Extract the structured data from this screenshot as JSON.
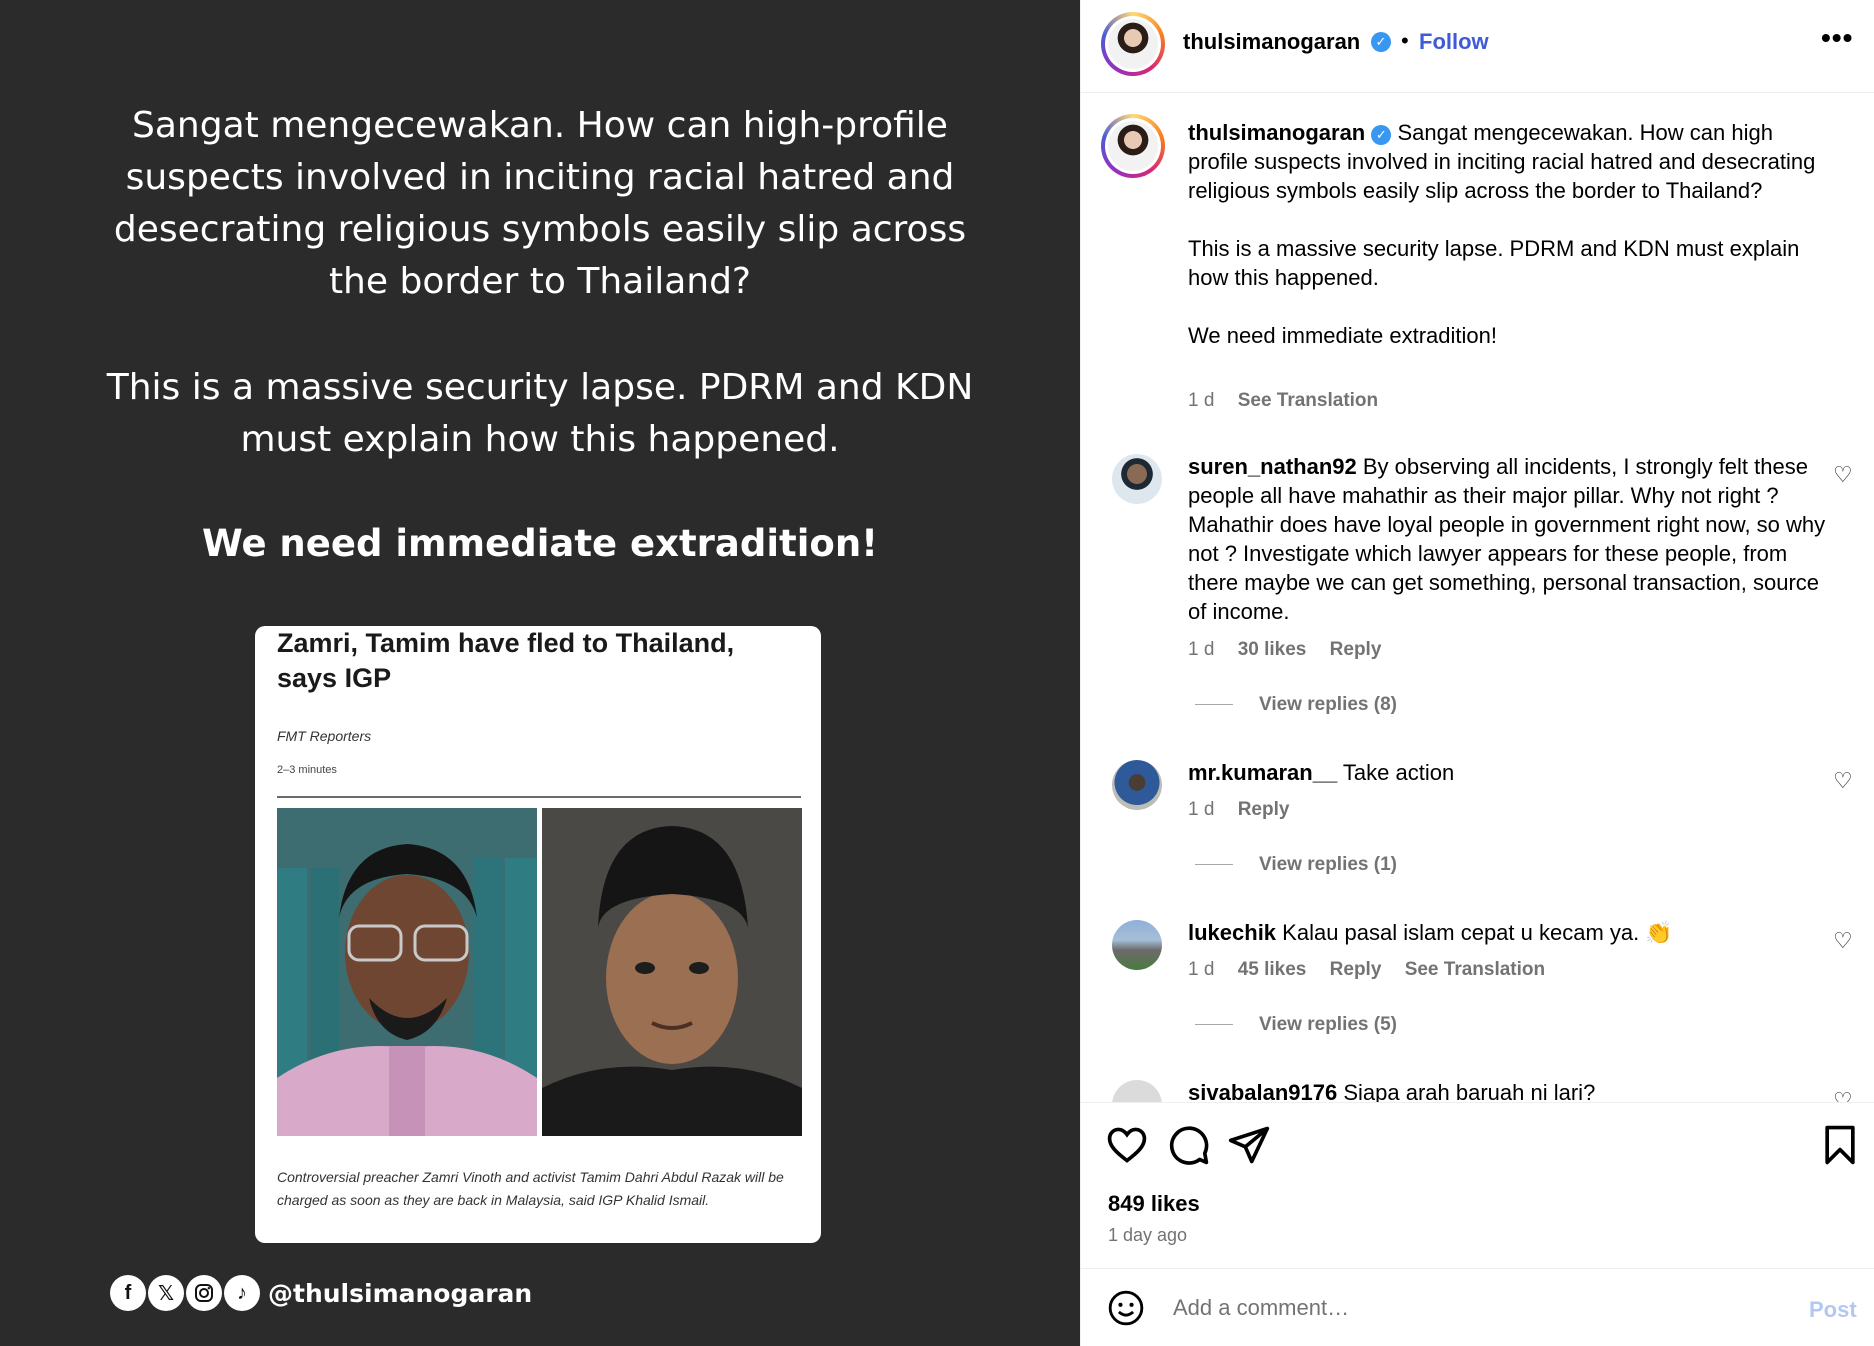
{
  "image": {
    "paragraph1": "Sangat mengecewakan. How can high-profile suspects involved in inciting racial hatred and desecrating religious symbols easily slip across the border to Thailand?",
    "paragraph2": "This is a massive security lapse. PDRM and KDN must explain how this happened.",
    "paragraph3": "We need immediate extradition!",
    "news_card": {
      "headline": "Zamri, Tamim have fled to Thailand, says IGP",
      "byline": "FMT Reporters",
      "read_time": "2–3 minutes",
      "caption": "Controversial preacher Zamri Vinoth and activist Tamim Dahri Abdul Razak will be charged as soon as they are back in Malaysia, said IGP Khalid Ismail."
    },
    "social_icons": [
      "facebook-icon",
      "x-icon",
      "instagram-icon",
      "tiktok-icon"
    ],
    "social_handle": "@thulsimanogaran"
  },
  "header": {
    "username": "thulsimanogaran",
    "verified": true,
    "dot": "•",
    "follow_label": "Follow",
    "more_label": "•••"
  },
  "caption": {
    "username": "thulsimanogaran",
    "text_line1": "Sangat mengecewakan. How can high profile suspects involved in inciting racial hatred and desecrating religious symbols easily slip across the border to Thailand?",
    "text_line2": "This is a massive security lapse. PDRM and KDN must explain how this happened.",
    "text_line3": "We need immediate extradition!",
    "time": "1 d",
    "see_translation": "See Translation"
  },
  "comments": [
    {
      "username": "suren_nathan92",
      "text": "By observing all incidents, I strongly felt these people all have mahathir as their major pillar. Why not right ? Mahathir does have loyal people in government right now, so why not ? Investigate which lawyer appears for these people, from there maybe we can get something, personal transaction, source of income.",
      "time": "1 d",
      "likes": "30 likes",
      "reply": "Reply",
      "view_replies": "View replies (8)"
    },
    {
      "username": "mr.kumaran__",
      "text": "Take action",
      "time": "1 d",
      "reply": "Reply",
      "view_replies": "View replies (1)"
    },
    {
      "username": "lukechik",
      "text": "Kalau pasal islam cepat u kecam ya. 👏",
      "time": "1 d",
      "likes": "45 likes",
      "reply": "Reply",
      "see_translation": "See Translation",
      "view_replies": "View replies (5)"
    },
    {
      "username": "sivabalan9176",
      "text": "Siapa arah baruah ni lari?"
    }
  ],
  "actions": {
    "likes": "849 likes",
    "time": "1 day ago"
  },
  "comment_bar": {
    "placeholder": "Add a comment…",
    "post_label": "Post"
  },
  "colors": {
    "follow": "#3f5bd8",
    "verified": "#3897f0",
    "meta_gray": "#737373",
    "post_disabled": "#b3c8f0",
    "image_bg": "#2b2b2b"
  }
}
